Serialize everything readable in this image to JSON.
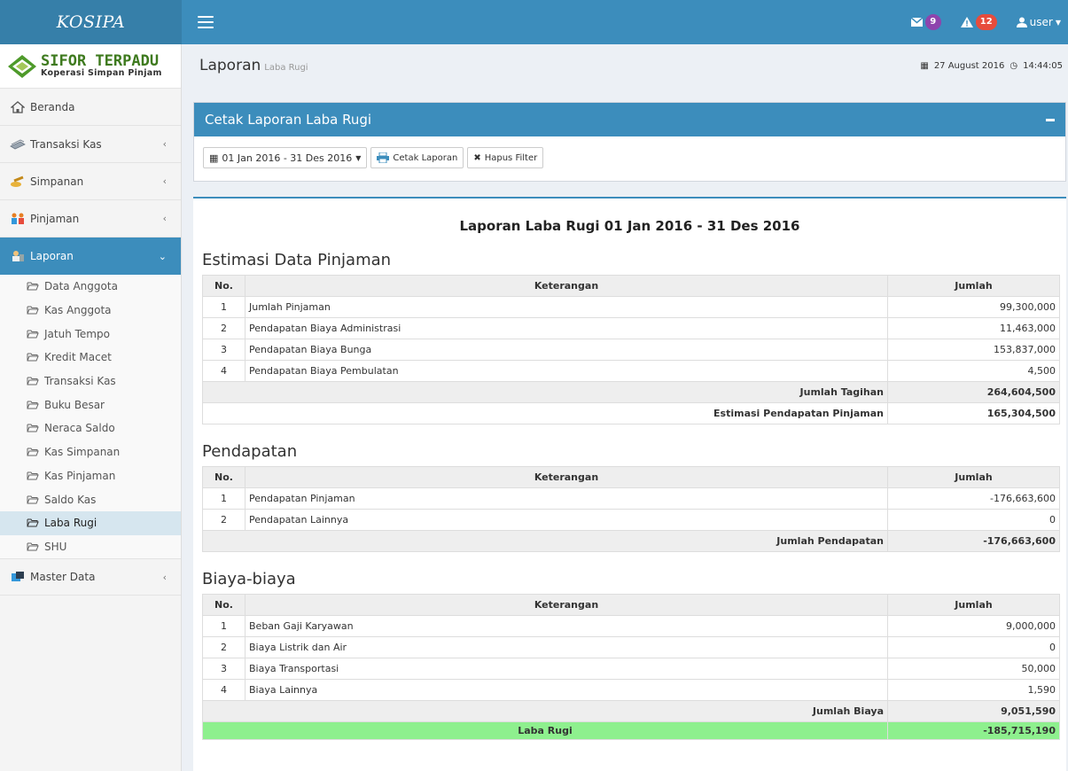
{
  "app": {
    "name": "KOSIPA"
  },
  "brand": {
    "line1": "SIFOR TERPADU",
    "line2": "Koperasi Simpan Pinjam"
  },
  "navbar": {
    "messages_count": "9",
    "alerts_count": "12",
    "user_label": "user",
    "colors": {
      "primary": "#3c8dbc",
      "dark": "#367fa9"
    }
  },
  "sidebar": {
    "items": [
      {
        "label": "Beranda",
        "icon": "home-icon"
      },
      {
        "label": "Transaksi Kas",
        "icon": "money-icon"
      },
      {
        "label": "Simpanan",
        "icon": "savings-icon"
      },
      {
        "label": "Pinjaman",
        "icon": "people-icon"
      },
      {
        "label": "Laporan",
        "icon": "report-icon"
      },
      {
        "label": "Master Data",
        "icon": "database-icon"
      }
    ],
    "submenu": [
      "Data Anggota",
      "Kas Anggota",
      "Jatuh Tempo",
      "Kredit Macet",
      "Transaksi Kas",
      "Buku Besar",
      "Neraca Saldo",
      "Kas Simpanan",
      "Kas Pinjaman",
      "Saldo Kas",
      "Laba Rugi",
      "SHU"
    ]
  },
  "header": {
    "title": "Laporan",
    "subtitle": "Laba Rugi",
    "date": "27 August 2016",
    "time": "14:44:05"
  },
  "filter_box": {
    "title": "Cetak Laporan Laba Rugi",
    "date_range": "01 Jan 2016 - 31 Des 2016",
    "print_label": "Cetak Laporan",
    "clear_label": "Hapus Filter"
  },
  "report": {
    "title": "Laporan Laba Rugi 01 Jan 2016 - 31 Des 2016",
    "col_no": "No.",
    "col_ket": "Keterangan",
    "col_jumlah": "Jumlah",
    "estimasi": {
      "title": "Estimasi Data Pinjaman",
      "rows": [
        {
          "no": "1",
          "ket": "Jumlah Pinjaman",
          "jumlah": "99,300,000"
        },
        {
          "no": "2",
          "ket": "Pendapatan Biaya Administrasi",
          "jumlah": "11,463,000"
        },
        {
          "no": "3",
          "ket": "Pendapatan Biaya Bunga",
          "jumlah": "153,837,000"
        },
        {
          "no": "4",
          "ket": "Pendapatan Biaya Pembulatan",
          "jumlah": "4,500"
        }
      ],
      "total_tagihan_label": "Jumlah Tagihan",
      "total_tagihan": "264,604,500",
      "estimasi_label": "Estimasi Pendapatan Pinjaman",
      "estimasi_value": "165,304,500"
    },
    "pendapatan": {
      "title": "Pendapatan",
      "rows": [
        {
          "no": "1",
          "ket": "Pendapatan Pinjaman",
          "jumlah": "-176,663,600"
        },
        {
          "no": "2",
          "ket": "Pendapatan Lainnya",
          "jumlah": "0"
        }
      ],
      "total_label": "Jumlah Pendapatan",
      "total": "-176,663,600"
    },
    "biaya": {
      "title": "Biaya-biaya",
      "rows": [
        {
          "no": "1",
          "ket": "Beban Gaji Karyawan",
          "jumlah": "9,000,000"
        },
        {
          "no": "2",
          "ket": "Biaya Listrik dan Air",
          "jumlah": "0"
        },
        {
          "no": "3",
          "ket": "Biaya Transportasi",
          "jumlah": "50,000"
        },
        {
          "no": "4",
          "ket": "Biaya Lainnya",
          "jumlah": "1,590"
        }
      ],
      "total_label": "Jumlah Biaya",
      "total": "9,051,590"
    },
    "laba_rugi_label": "Laba Rugi",
    "laba_rugi_value": "-185,715,190"
  }
}
